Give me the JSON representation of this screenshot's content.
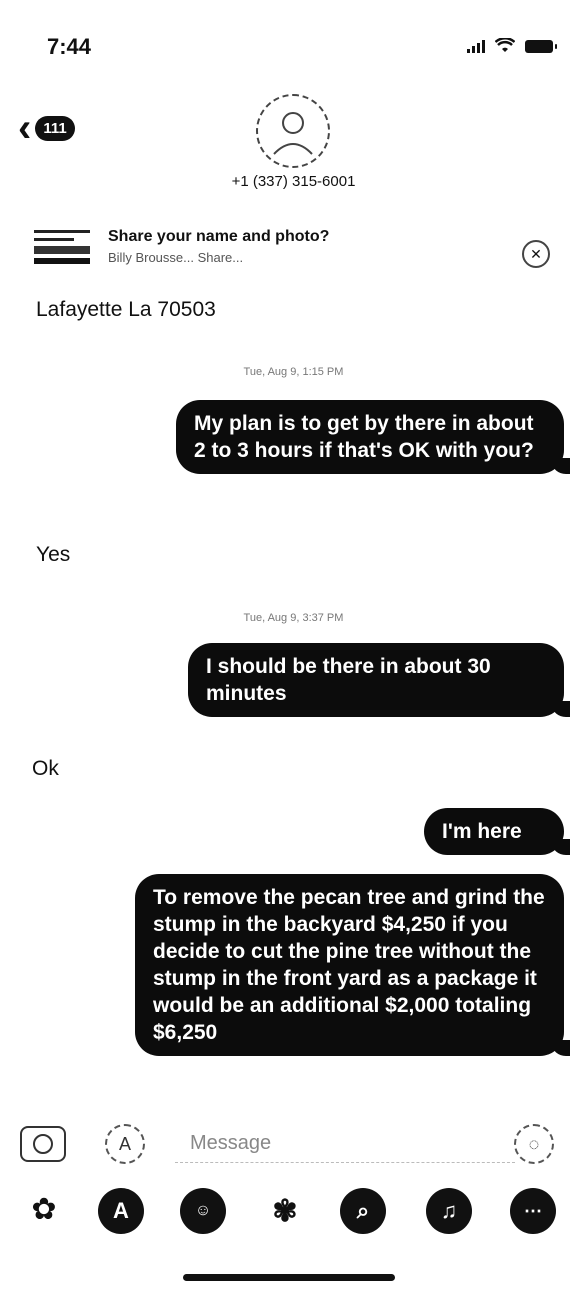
{
  "status_bar": {
    "time": "7:44"
  },
  "header": {
    "back_badge": "111",
    "contact_phone": "+1 (337) 315-6001"
  },
  "share_banner": {
    "title": "Share your name and photo?",
    "subtitle": "Billy Brousse... Share..."
  },
  "messages": {
    "incoming_1": "Lafayette La 70503",
    "timestamp_1": "Tue, Aug 9, 1:15 PM",
    "outgoing_1": "My plan is to get by there in about 2 to 3 hours if that's OK with you?",
    "incoming_2": "Yes",
    "timestamp_2": "Tue, Aug 9, 3:37 PM",
    "outgoing_2": "I should be there in about 30 minutes",
    "incoming_3": "Ok",
    "outgoing_3": "I'm here",
    "outgoing_4": "To remove the pecan tree and grind the stump in the backyard $4,250 if you decide to cut the pine tree without the stump in the front yard as a package it would be an additional $2,000 totaling $6,250"
  },
  "input": {
    "placeholder": "Message"
  },
  "app_drawer": [
    "photos",
    "app-store",
    "memoji",
    "digital-touch",
    "search-images",
    "music",
    "more"
  ]
}
